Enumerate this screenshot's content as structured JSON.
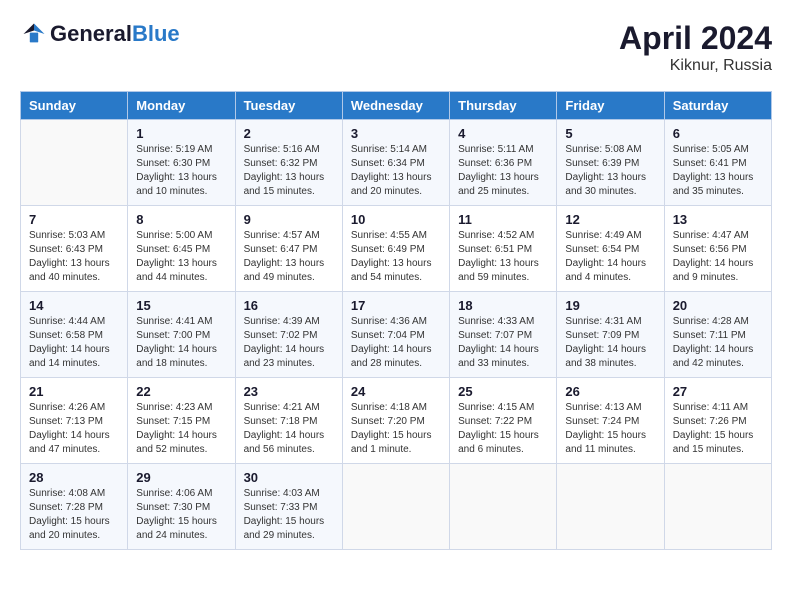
{
  "logo": {
    "name_part1": "General",
    "name_part2": "Blue"
  },
  "header": {
    "month": "April 2024",
    "location": "Kiknur, Russia"
  },
  "weekdays": [
    "Sunday",
    "Monday",
    "Tuesday",
    "Wednesday",
    "Thursday",
    "Friday",
    "Saturday"
  ],
  "weeks": [
    [
      {
        "day": "",
        "sunrise": "",
        "sunset": "",
        "daylight": ""
      },
      {
        "day": "1",
        "sunrise": "Sunrise: 5:19 AM",
        "sunset": "Sunset: 6:30 PM",
        "daylight": "Daylight: 13 hours and 10 minutes."
      },
      {
        "day": "2",
        "sunrise": "Sunrise: 5:16 AM",
        "sunset": "Sunset: 6:32 PM",
        "daylight": "Daylight: 13 hours and 15 minutes."
      },
      {
        "day": "3",
        "sunrise": "Sunrise: 5:14 AM",
        "sunset": "Sunset: 6:34 PM",
        "daylight": "Daylight: 13 hours and 20 minutes."
      },
      {
        "day": "4",
        "sunrise": "Sunrise: 5:11 AM",
        "sunset": "Sunset: 6:36 PM",
        "daylight": "Daylight: 13 hours and 25 minutes."
      },
      {
        "day": "5",
        "sunrise": "Sunrise: 5:08 AM",
        "sunset": "Sunset: 6:39 PM",
        "daylight": "Daylight: 13 hours and 30 minutes."
      },
      {
        "day": "6",
        "sunrise": "Sunrise: 5:05 AM",
        "sunset": "Sunset: 6:41 PM",
        "daylight": "Daylight: 13 hours and 35 minutes."
      }
    ],
    [
      {
        "day": "7",
        "sunrise": "Sunrise: 5:03 AM",
        "sunset": "Sunset: 6:43 PM",
        "daylight": "Daylight: 13 hours and 40 minutes."
      },
      {
        "day": "8",
        "sunrise": "Sunrise: 5:00 AM",
        "sunset": "Sunset: 6:45 PM",
        "daylight": "Daylight: 13 hours and 44 minutes."
      },
      {
        "day": "9",
        "sunrise": "Sunrise: 4:57 AM",
        "sunset": "Sunset: 6:47 PM",
        "daylight": "Daylight: 13 hours and 49 minutes."
      },
      {
        "day": "10",
        "sunrise": "Sunrise: 4:55 AM",
        "sunset": "Sunset: 6:49 PM",
        "daylight": "Daylight: 13 hours and 54 minutes."
      },
      {
        "day": "11",
        "sunrise": "Sunrise: 4:52 AM",
        "sunset": "Sunset: 6:51 PM",
        "daylight": "Daylight: 13 hours and 59 minutes."
      },
      {
        "day": "12",
        "sunrise": "Sunrise: 4:49 AM",
        "sunset": "Sunset: 6:54 PM",
        "daylight": "Daylight: 14 hours and 4 minutes."
      },
      {
        "day": "13",
        "sunrise": "Sunrise: 4:47 AM",
        "sunset": "Sunset: 6:56 PM",
        "daylight": "Daylight: 14 hours and 9 minutes."
      }
    ],
    [
      {
        "day": "14",
        "sunrise": "Sunrise: 4:44 AM",
        "sunset": "Sunset: 6:58 PM",
        "daylight": "Daylight: 14 hours and 14 minutes."
      },
      {
        "day": "15",
        "sunrise": "Sunrise: 4:41 AM",
        "sunset": "Sunset: 7:00 PM",
        "daylight": "Daylight: 14 hours and 18 minutes."
      },
      {
        "day": "16",
        "sunrise": "Sunrise: 4:39 AM",
        "sunset": "Sunset: 7:02 PM",
        "daylight": "Daylight: 14 hours and 23 minutes."
      },
      {
        "day": "17",
        "sunrise": "Sunrise: 4:36 AM",
        "sunset": "Sunset: 7:04 PM",
        "daylight": "Daylight: 14 hours and 28 minutes."
      },
      {
        "day": "18",
        "sunrise": "Sunrise: 4:33 AM",
        "sunset": "Sunset: 7:07 PM",
        "daylight": "Daylight: 14 hours and 33 minutes."
      },
      {
        "day": "19",
        "sunrise": "Sunrise: 4:31 AM",
        "sunset": "Sunset: 7:09 PM",
        "daylight": "Daylight: 14 hours and 38 minutes."
      },
      {
        "day": "20",
        "sunrise": "Sunrise: 4:28 AM",
        "sunset": "Sunset: 7:11 PM",
        "daylight": "Daylight: 14 hours and 42 minutes."
      }
    ],
    [
      {
        "day": "21",
        "sunrise": "Sunrise: 4:26 AM",
        "sunset": "Sunset: 7:13 PM",
        "daylight": "Daylight: 14 hours and 47 minutes."
      },
      {
        "day": "22",
        "sunrise": "Sunrise: 4:23 AM",
        "sunset": "Sunset: 7:15 PM",
        "daylight": "Daylight: 14 hours and 52 minutes."
      },
      {
        "day": "23",
        "sunrise": "Sunrise: 4:21 AM",
        "sunset": "Sunset: 7:18 PM",
        "daylight": "Daylight: 14 hours and 56 minutes."
      },
      {
        "day": "24",
        "sunrise": "Sunrise: 4:18 AM",
        "sunset": "Sunset: 7:20 PM",
        "daylight": "Daylight: 15 hours and 1 minute."
      },
      {
        "day": "25",
        "sunrise": "Sunrise: 4:15 AM",
        "sunset": "Sunset: 7:22 PM",
        "daylight": "Daylight: 15 hours and 6 minutes."
      },
      {
        "day": "26",
        "sunrise": "Sunrise: 4:13 AM",
        "sunset": "Sunset: 7:24 PM",
        "daylight": "Daylight: 15 hours and 11 minutes."
      },
      {
        "day": "27",
        "sunrise": "Sunrise: 4:11 AM",
        "sunset": "Sunset: 7:26 PM",
        "daylight": "Daylight: 15 hours and 15 minutes."
      }
    ],
    [
      {
        "day": "28",
        "sunrise": "Sunrise: 4:08 AM",
        "sunset": "Sunset: 7:28 PM",
        "daylight": "Daylight: 15 hours and 20 minutes."
      },
      {
        "day": "29",
        "sunrise": "Sunrise: 4:06 AM",
        "sunset": "Sunset: 7:30 PM",
        "daylight": "Daylight: 15 hours and 24 minutes."
      },
      {
        "day": "30",
        "sunrise": "Sunrise: 4:03 AM",
        "sunset": "Sunset: 7:33 PM",
        "daylight": "Daylight: 15 hours and 29 minutes."
      },
      {
        "day": "",
        "sunrise": "",
        "sunset": "",
        "daylight": ""
      },
      {
        "day": "",
        "sunrise": "",
        "sunset": "",
        "daylight": ""
      },
      {
        "day": "",
        "sunrise": "",
        "sunset": "",
        "daylight": ""
      },
      {
        "day": "",
        "sunrise": "",
        "sunset": "",
        "daylight": ""
      }
    ]
  ]
}
